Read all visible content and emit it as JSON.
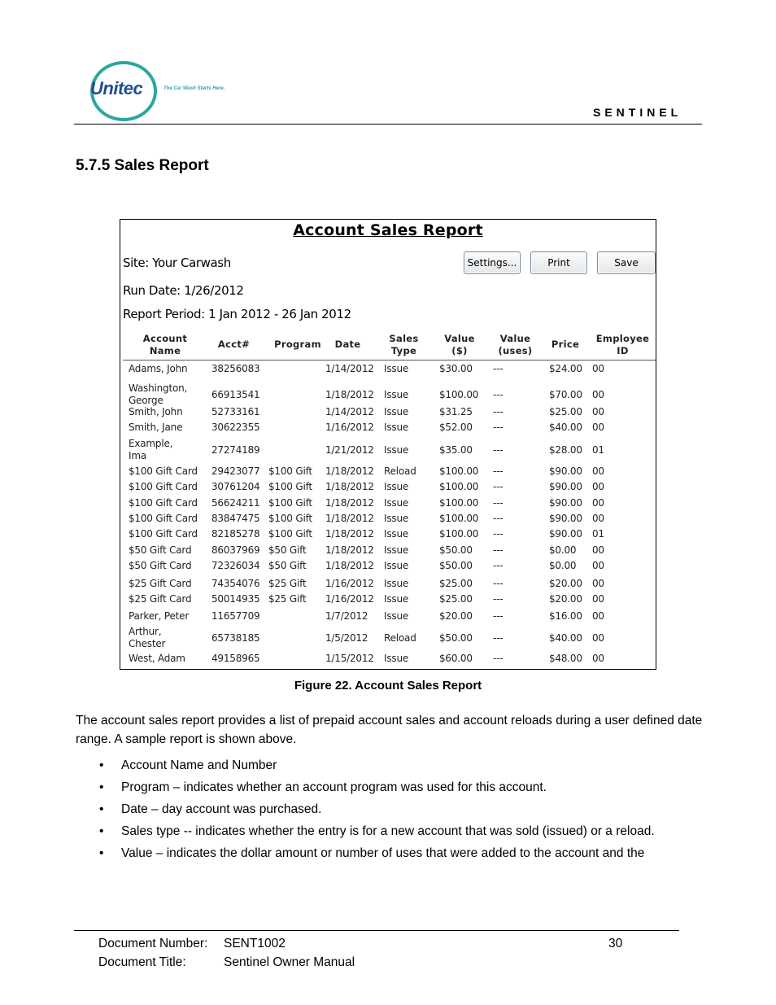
{
  "header": {
    "logo_text": "Unitec",
    "tagline": "The Car Wash Starts Here.",
    "brand": "SENTINEL"
  },
  "section": {
    "title": "5.7.5  Sales Report"
  },
  "report": {
    "title": "Account Sales Report",
    "site": "Site: Your Carwash",
    "run_date": "Run Date: 1/26/2012",
    "period": "Report Period: 1 Jan 2012 - 26 Jan 2012",
    "buttons": {
      "settings": "Settings...",
      "print": "Print",
      "save": "Save"
    },
    "columns": [
      [
        "Account",
        "Name"
      ],
      [
        "Acct#"
      ],
      [
        "Program"
      ],
      [
        "Date"
      ],
      [
        "Sales",
        "Type"
      ],
      [
        "Value",
        "($)"
      ],
      [
        "Value",
        "(uses)"
      ],
      [
        "Price"
      ],
      [
        "Employee",
        "ID"
      ]
    ],
    "rows": [
      {
        "name": [
          "Adams, John"
        ],
        "acct": "38256083",
        "program": "",
        "date": "1/14/2012",
        "type": "Issue",
        "value": "$30.00",
        "uses": "---",
        "price": "$24.00",
        "emp": "00"
      },
      {
        "name": [
          "Washington,",
          "George"
        ],
        "acct": "66913541",
        "program": "",
        "date": "1/18/2012",
        "type": "Issue",
        "value": "$100.00",
        "uses": "---",
        "price": "$70.00",
        "emp": "00"
      },
      {
        "name": [
          "Smith, John"
        ],
        "acct": "52733161",
        "program": "",
        "date": "1/14/2012",
        "type": "Issue",
        "value": "$31.25",
        "uses": "---",
        "price": "$25.00",
        "emp": "00"
      },
      {
        "name": [
          "Smith, Jane"
        ],
        "acct": "30622355",
        "program": "",
        "date": "1/16/2012",
        "type": "Issue",
        "value": "$52.00",
        "uses": "---",
        "price": "$40.00",
        "emp": "00"
      },
      {
        "name": [
          "Example,",
          "Ima"
        ],
        "acct": "27274189",
        "program": "",
        "date": "1/21/2012",
        "type": "Issue",
        "value": "$35.00",
        "uses": "---",
        "price": "$28.00",
        "emp": "01"
      },
      {
        "name": [
          "$100 Gift Card"
        ],
        "acct": "29423077",
        "program": "$100 Gift",
        "date": "1/18/2012",
        "type": "Reload",
        "value": "$100.00",
        "uses": "---",
        "price": "$90.00",
        "emp": "00"
      },
      {
        "name": [
          "$100 Gift Card"
        ],
        "acct": "30761204",
        "program": "$100 Gift",
        "date": "1/18/2012",
        "type": "Issue",
        "value": "$100.00",
        "uses": "---",
        "price": "$90.00",
        "emp": "00"
      },
      {
        "name": [
          "$100 Gift Card"
        ],
        "acct": "56624211",
        "program": "$100 Gift",
        "date": "1/18/2012",
        "type": "Issue",
        "value": "$100.00",
        "uses": "---",
        "price": "$90.00",
        "emp": "00"
      },
      {
        "name": [
          "$100 Gift Card"
        ],
        "acct": "83847475",
        "program": "$100 Gift",
        "date": "1/18/2012",
        "type": "Issue",
        "value": "$100.00",
        "uses": "---",
        "price": "$90.00",
        "emp": "00"
      },
      {
        "name": [
          "$100 Gift Card"
        ],
        "acct": "82185278",
        "program": "$100 Gift",
        "date": "1/18/2012",
        "type": "Issue",
        "value": "$100.00",
        "uses": "---",
        "price": "$90.00",
        "emp": "01"
      },
      {
        "name": [
          "$50 Gift Card"
        ],
        "acct": "86037969",
        "program": "$50 Gift",
        "date": "1/18/2012",
        "type": "Issue",
        "value": "$50.00",
        "uses": "---",
        "price": "$0.00",
        "emp": "00"
      },
      {
        "name": [
          "$50 Gift Card"
        ],
        "acct": "72326034",
        "program": "$50 Gift",
        "date": "1/18/2012",
        "type": "Issue",
        "value": "$50.00",
        "uses": "---",
        "price": "$0.00",
        "emp": "00"
      },
      {
        "name": [
          "$25 Gift Card"
        ],
        "acct": "74354076",
        "program": "$25 Gift",
        "date": "1/16/2012",
        "type": "Issue",
        "value": "$25.00",
        "uses": "---",
        "price": "$20.00",
        "emp": "00"
      },
      {
        "name": [
          "$25 Gift Card"
        ],
        "acct": "50014935",
        "program": "$25 Gift",
        "date": "1/16/2012",
        "type": "Issue",
        "value": "$25.00",
        "uses": "---",
        "price": "$20.00",
        "emp": "00"
      },
      {
        "name": [
          "Parker, Peter"
        ],
        "acct": "11657709",
        "program": "",
        "date": "1/7/2012",
        "type": "Issue",
        "value": "$20.00",
        "uses": "---",
        "price": "$16.00",
        "emp": "00"
      },
      {
        "name": [
          "Arthur,",
          "Chester"
        ],
        "acct": "65738185",
        "program": "",
        "date": "1/5/2012",
        "type": "Reload",
        "value": "$50.00",
        "uses": "---",
        "price": "$40.00",
        "emp": "00"
      },
      {
        "name": [
          "West, Adam"
        ],
        "acct": "49158965",
        "program": "",
        "date": "1/15/2012",
        "type": "Issue",
        "value": "$60.00",
        "uses": "---",
        "price": "$48.00",
        "emp": "00"
      }
    ]
  },
  "caption": "Figure 22. Account Sales Report",
  "intro": "The account sales report provides a list of prepaid account sales and account reloads during a user defined date range. A sample report is shown above.",
  "bullets": [
    "Account Name and Number",
    "Program – indicates whether an account program was used for this account.",
    "Date – day account was purchased.",
    "Sales type -- indicates whether the entry is for a new account that was sold  (issued) or a reload.",
    "Value – indicates the dollar amount or number of uses that were added to the account and the"
  ],
  "footer": {
    "doc_number_label": "Document Number:",
    "doc_number": "SENT1002",
    "doc_title_label": "Document Title:",
    "doc_title": "Sentinel Owner Manual",
    "page": "30"
  }
}
